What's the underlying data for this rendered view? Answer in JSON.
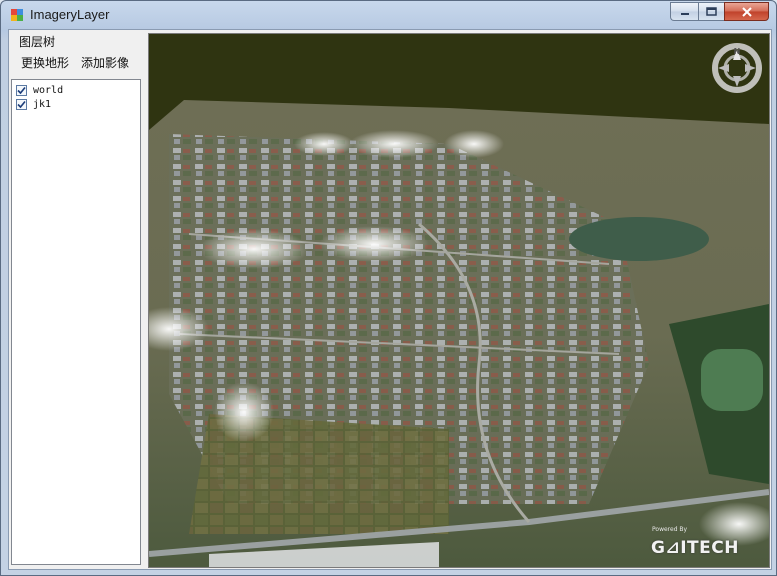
{
  "window": {
    "title": "ImageryLayer"
  },
  "left_panel": {
    "group_title": "图层树",
    "toolbar": {
      "change_terrain_label": "更换地形",
      "add_imagery_label": "添加影像"
    },
    "layers": [
      {
        "label": "world",
        "checked": true
      },
      {
        "label": "jk1",
        "checked": true
      }
    ]
  },
  "viewer": {
    "powered_text": "Powered By",
    "brand_text": "G⊿ITECH",
    "compass_north": "N"
  },
  "colors": {
    "sky": "#2f3411",
    "terrain": "#5c6a48",
    "water": "#3f5d4a",
    "close_button": "#c44a32"
  }
}
